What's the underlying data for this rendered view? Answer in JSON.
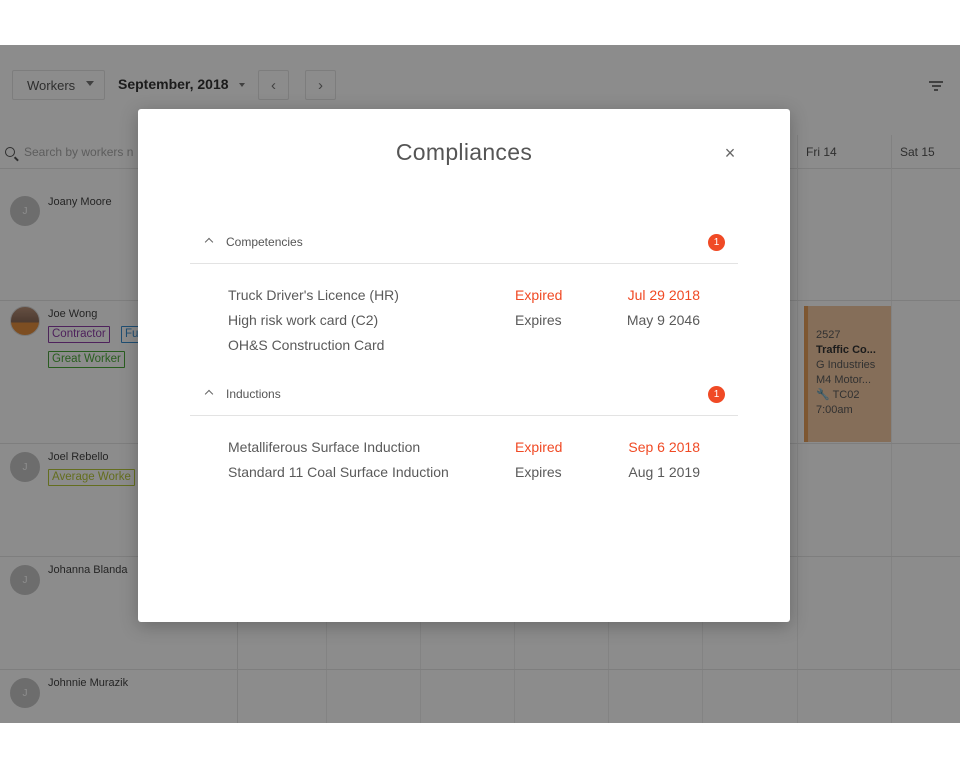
{
  "toolbar": {
    "workers_label": "Workers",
    "month_label": "September, 2018",
    "prev_glyph": "‹",
    "next_glyph": "›"
  },
  "calendar": {
    "search_placeholder": "Search by workers n",
    "days": [
      "Fri 14",
      "Sat 15"
    ]
  },
  "workers": [
    {
      "name": "Joany Moore",
      "initial": "J"
    },
    {
      "name": "Joe Wong",
      "initial": "",
      "tags": [
        "Contractor",
        "Fu",
        "Great Worker"
      ]
    },
    {
      "name": "Joel Rebello",
      "initial": "J",
      "tags": [
        "Average Worke"
      ]
    },
    {
      "name": "Johanna Blanda",
      "initial": "J"
    },
    {
      "name": "Johnnie Murazik",
      "initial": "J"
    }
  ],
  "shift": {
    "id": "2527",
    "title": "Traffic Co...",
    "company": "G Industries",
    "location": "M4 Motor...",
    "code": "TC02",
    "time": "7:00am",
    "color": "#f3c9a3"
  },
  "modal": {
    "title": "Compliances",
    "close_glyph": "×",
    "sections": [
      {
        "label": "Competencies",
        "badge": "1",
        "items": [
          {
            "name": "Truck Driver's Licence (HR)",
            "status": "Expired",
            "date": "Jul 29 2018"
          },
          {
            "name": "High risk work card (C2)",
            "status": "Expires",
            "date": "May 9 2046"
          },
          {
            "name": "OH&S Construction Card",
            "status": "",
            "date": ""
          }
        ]
      },
      {
        "label": "Inductions",
        "badge": "1",
        "items": [
          {
            "name": "Metalliferous Surface Induction",
            "status": "Expired",
            "date": "Sep 6 2018"
          },
          {
            "name": "Standard 11 Coal Surface Induction",
            "status": "Expires",
            "date": "Aug 1 2019"
          }
        ]
      }
    ]
  },
  "colors": {
    "expired": "#f04a25",
    "badge": "#f04a25",
    "tag_contractor": "#8e3ea8",
    "tag_fulltime": "#3a8fd0",
    "tag_great": "#4caa3a",
    "tag_average": "#b6c93a"
  }
}
